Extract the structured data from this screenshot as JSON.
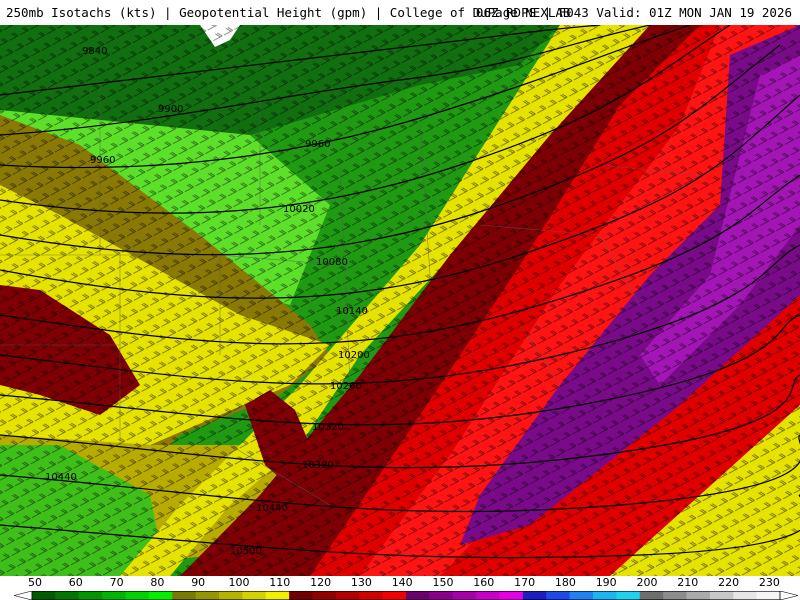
{
  "header": {
    "product": "250mb Isotachs (kts) | Geopotential Height (gpm) | College of DuPage NEXLAB",
    "run_info": "06Z RDPS | F043 Valid: 01Z MON JAN 19 2026"
  },
  "height_contour_labels": [
    "9840",
    "9900",
    "9960",
    "9960",
    "10020",
    "10080",
    "10140",
    "10200",
    "10260",
    "10320",
    "10380",
    "10440",
    "10440",
    "10500"
  ],
  "colorbar": {
    "labels": [
      "50",
      "60",
      "70",
      "80",
      "90",
      "100",
      "110",
      "120",
      "130",
      "140",
      "150",
      "160",
      "170",
      "180",
      "190",
      "200",
      "210",
      "220",
      "230"
    ],
    "colors": [
      "#005c00",
      "#007800",
      "#009600",
      "#00b400",
      "#00d200",
      "#00f000",
      "#7a7a00",
      "#969600",
      "#b4b400",
      "#d2d200",
      "#f0f000",
      "#700000",
      "#900000",
      "#b00000",
      "#d00000",
      "#f00000",
      "#6c006c",
      "#8a008a",
      "#a800a8",
      "#c600c6",
      "#e400e4",
      "#1e1ebe",
      "#1e4be6",
      "#1e82f0",
      "#1eb4f0",
      "#1ed2f0",
      "#6e6e6e",
      "#8c8c8c",
      "#aaaaaa",
      "#c8c8c8",
      "#e6e6e6",
      "#f5f5f5"
    ]
  },
  "speed_colors": {
    "g50": "#116f0f",
    "g60": "#1f9a12",
    "g70": "#3fbf1a",
    "g80": "#5ce02a",
    "y90": "#8a7a05",
    "y100": "#b9ac00",
    "y110": "#e6e300",
    "r120": "#7e0004",
    "r130": "#a60002",
    "r140": "#e00000",
    "r150": "#ff1414",
    "p160": "#7a0b88",
    "p170": "#a316b5"
  }
}
